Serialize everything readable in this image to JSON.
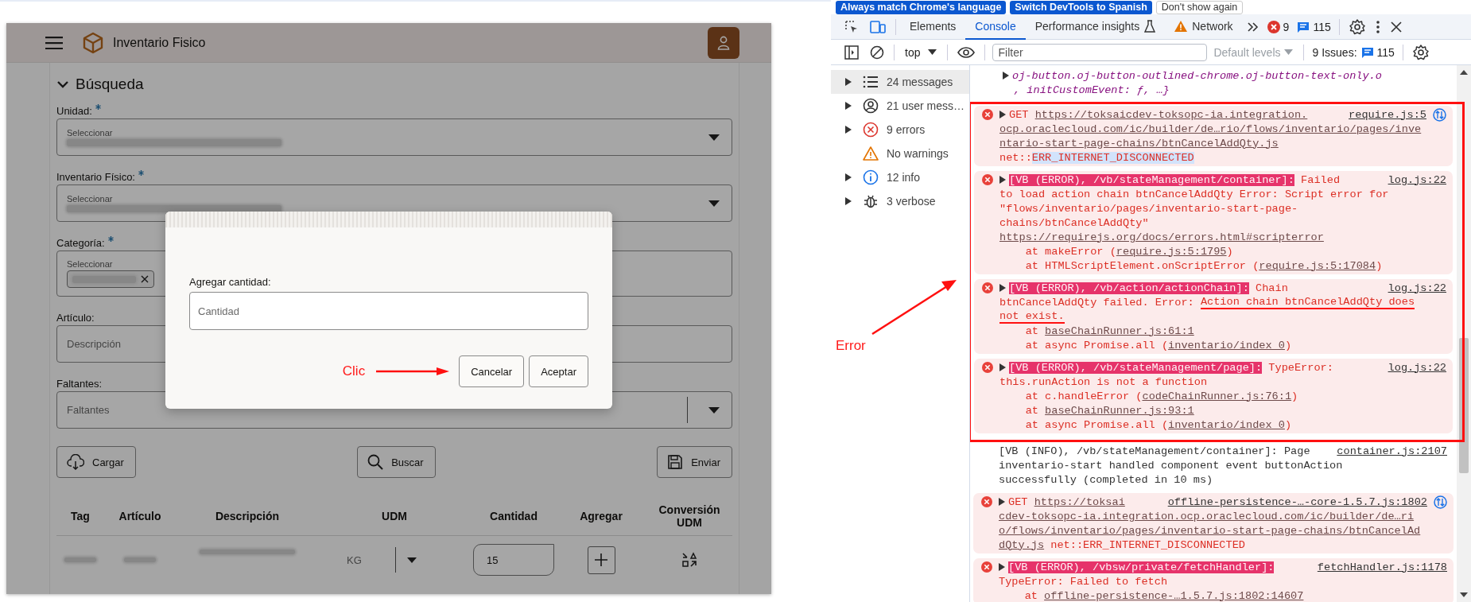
{
  "app": {
    "title": "Inventario Fisico",
    "search_section": {
      "title": "Búsqueda",
      "expanded": true,
      "fields": [
        {
          "kind": "select",
          "label": "Unidad:",
          "required": true,
          "hint": "Seleccionar"
        },
        {
          "kind": "select",
          "label": "Inventario Físico:",
          "required": true,
          "hint": "Seleccionar"
        },
        {
          "kind": "chips",
          "label": "Categoría:",
          "required": true,
          "hint": "Seleccionar"
        },
        {
          "kind": "text",
          "label": "Artículo:",
          "required": false,
          "placeholder": "Descripción"
        },
        {
          "kind": "combo",
          "label": "Faltantes:",
          "required": false,
          "placeholder": "Faltantes"
        }
      ],
      "buttons": [
        "Cargar",
        "Buscar",
        "Enviar"
      ]
    },
    "table": {
      "columns": [
        "Tag",
        "Artículo",
        "Descripción",
        "UDM",
        "Cantidad",
        "Agregar",
        "Conversión UDM"
      ],
      "rows": [
        {
          "udm": "KG",
          "cantidad": "15"
        }
      ]
    }
  },
  "dialog": {
    "label": "Agregar cantidad:",
    "placeholder": "Cantidad",
    "buttons": [
      "Cancelar",
      "Aceptar"
    ],
    "annotation": "Clic"
  },
  "devtools": {
    "language_bar": [
      {
        "label": "Always match Chrome's language",
        "kind": "primary"
      },
      {
        "label": "Switch DevTools to Spanish",
        "kind": "primary"
      },
      {
        "label": "Don't show again",
        "kind": "secondary"
      }
    ],
    "tabs": [
      {
        "label": "Elements",
        "selected": false,
        "kind": "plain"
      },
      {
        "label": "Console",
        "selected": true,
        "kind": "plain"
      },
      {
        "label": "Performance insights",
        "selected": false,
        "kind": "experimental"
      },
      {
        "label": "Network",
        "selected": false,
        "kind": "warning"
      }
    ],
    "error_count": "9",
    "message_count": "115",
    "toolbar": {
      "context": "top",
      "filter_placeholder": "Filter",
      "levels": "Default levels",
      "issues_label": "9 Issues:",
      "issues_count": "115"
    },
    "sidebar": [
      {
        "label": "24 messages",
        "kind": "messages",
        "expandable": true,
        "selected": true
      },
      {
        "label": "21 user mess…",
        "kind": "user",
        "expandable": true,
        "selected": false
      },
      {
        "label": "9 errors",
        "kind": "error",
        "expandable": true,
        "selected": false
      },
      {
        "label": "No warnings",
        "kind": "warning",
        "expandable": false,
        "selected": false
      },
      {
        "label": "12 info",
        "kind": "info",
        "expandable": true,
        "selected": false
      },
      {
        "label": "3 verbose",
        "kind": "verbose",
        "expandable": true,
        "selected": false
      }
    ],
    "console": {
      "before": [
        {
          "kind": "object",
          "expandable": true,
          "lines": [
            [
              {
                "kind": "object",
                "t": "oj-button.oj-button-outlined-chrome.oj-button-text-only.o"
              }
            ],
            [
              {
                "kind": "object",
                "t": ", initCustomEvent: ƒ, …}"
              }
            ]
          ]
        }
      ],
      "boxed": [
        {
          "kind": "error",
          "expandable": true,
          "source": "require.js:5",
          "network": true,
          "lines": [
            [
              {
                "kind": "text",
                "t": "GET "
              },
              {
                "kind": "link",
                "t": "https://toksaicdev-toksopc-ia.integration."
              }
            ],
            [
              {
                "kind": "link",
                "t": "ocp.oraclecloud.com/ic/builder/de…rio/flows/inventario/pages/inve"
              }
            ],
            [
              {
                "kind": "link",
                "t": "ntario-start-page-chains/btnCancelAddQty.js"
              }
            ],
            [
              {
                "kind": "text",
                "t": "net::"
              },
              {
                "kind": "selected",
                "t": "ERR_INTERNET_DISCONNECTED"
              }
            ]
          ]
        },
        {
          "kind": "error",
          "expandable": true,
          "source": "log.js:22",
          "network": false,
          "lines": [
            [
              {
                "kind": "tag",
                "t": "[VB (ERROR), /vb/stateManagement/container]:"
              },
              {
                "kind": "text",
                "t": " Failed"
              }
            ],
            [
              {
                "kind": "text",
                "t": "to load action chain btnCancelAddQty Error: Script error for"
              }
            ],
            [
              {
                "kind": "text",
                "t": "\"flows/inventario/pages/inventario-start-page-"
              }
            ],
            [
              {
                "kind": "text",
                "t": "chains/btnCancelAddQty\""
              }
            ],
            [
              {
                "kind": "link",
                "t": "https://requirejs.org/docs/errors.html#scripterror"
              }
            ],
            [
              {
                "kind": "text",
                "t": "    at makeError ("
              },
              {
                "kind": "link",
                "t": "require.js:5:1795"
              },
              {
                "kind": "text",
                "t": ")"
              }
            ],
            [
              {
                "kind": "text",
                "t": "    at HTMLScriptElement.onScriptError ("
              },
              {
                "kind": "link",
                "t": "require.js:5:17084"
              },
              {
                "kind": "text",
                "t": ")"
              }
            ]
          ]
        },
        {
          "kind": "error",
          "expandable": true,
          "source": "log.js:22",
          "network": false,
          "lines": [
            [
              {
                "kind": "tag",
                "t": "[VB (ERROR), /vb/action/actionChain]:"
              },
              {
                "kind": "text",
                "t": " Chain"
              }
            ],
            [
              {
                "kind": "text",
                "t": "btnCancelAddQty failed. Error: "
              },
              {
                "kind": "marked",
                "t": "Action chain btnCancelAddQty does"
              }
            ],
            [
              {
                "kind": "marked",
                "t": "not exist."
              }
            ],
            [
              {
                "kind": "text",
                "t": "    at "
              },
              {
                "kind": "link",
                "t": "baseChainRunner.js:61:1"
              }
            ],
            [
              {
                "kind": "text",
                "t": "    at async Promise.all ("
              },
              {
                "kind": "link",
                "t": "inventario/index 0"
              },
              {
                "kind": "text",
                "t": ")"
              }
            ]
          ]
        },
        {
          "kind": "error",
          "expandable": true,
          "source": "log.js:22",
          "network": false,
          "lines": [
            [
              {
                "kind": "tag",
                "t": "[VB (ERROR), /vb/stateManagement/page]:"
              },
              {
                "kind": "text",
                "t": " TypeError:"
              }
            ],
            [
              {
                "kind": "text",
                "t": "this.runAction is not a function"
              }
            ],
            [
              {
                "kind": "text",
                "t": "    at c.handleError ("
              },
              {
                "kind": "link",
                "t": "codeChainRunner.js:76:1"
              },
              {
                "kind": "text",
                "t": ")"
              }
            ],
            [
              {
                "kind": "text",
                "t": "    at "
              },
              {
                "kind": "link",
                "t": "baseChainRunner.js:93:1"
              }
            ],
            [
              {
                "kind": "text",
                "t": "    at async Promise.all ("
              },
              {
                "kind": "link",
                "t": "inventario/index 0"
              },
              {
                "kind": "text",
                "t": ")"
              }
            ]
          ]
        }
      ],
      "after": [
        {
          "kind": "info",
          "expandable": false,
          "source": "container.js:2107",
          "network": false,
          "lines": [
            [
              {
                "kind": "text",
                "t": "[VB (INFO), /vb/stateManagement/container]: Page"
              }
            ],
            [
              {
                "kind": "text",
                "t": "inventario-start handled component event buttonAction"
              }
            ],
            [
              {
                "kind": "text",
                "t": "successfully (completed in 10 ms)"
              }
            ]
          ]
        },
        {
          "kind": "error",
          "expandable": true,
          "source": "offline-persistence-…-core-1.5.7.js:1802",
          "network": true,
          "lines": [
            [
              {
                "kind": "text",
                "t": "GET "
              },
              {
                "kind": "link",
                "t": "https://toksai"
              }
            ],
            [
              {
                "kind": "link",
                "t": "cdev-toksopc-ia.integration.ocp.oraclecloud.com/ic/builder/de…ri"
              }
            ],
            [
              {
                "kind": "link",
                "t": "o/flows/inventario/pages/inventario-start-page-chains/btnCancelAd"
              }
            ],
            [
              {
                "kind": "link",
                "t": "dQty.js"
              },
              {
                "kind": "text",
                "t": " net::ERR_INTERNET_DISCONNECTED"
              }
            ]
          ]
        },
        {
          "kind": "error",
          "expandable": true,
          "source": "fetchHandler.js:1178",
          "network": false,
          "lines": [
            [
              {
                "kind": "tag",
                "t": "[VB (ERROR), /vbsw/private/fetchHandler]:"
              }
            ],
            [
              {
                "kind": "text",
                "t": "TypeError: Failed to fetch"
              }
            ],
            [
              {
                "kind": "text",
                "t": "    at "
              },
              {
                "kind": "link",
                "t": "offline-persistence-…1.5.7.js:1802:14607"
              }
            ]
          ]
        }
      ]
    },
    "annotation": "Error"
  }
}
